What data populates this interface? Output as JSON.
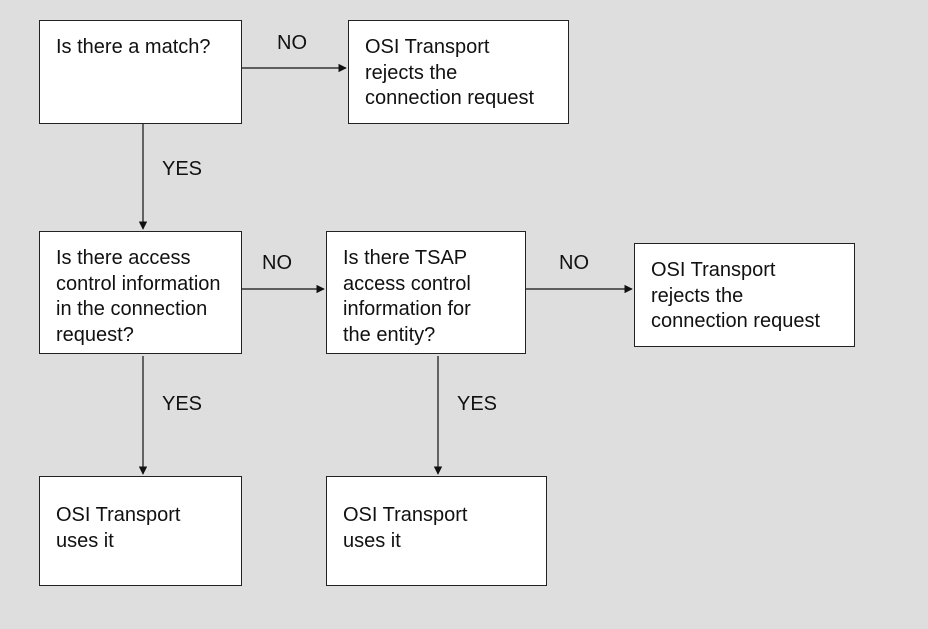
{
  "boxes": {
    "b1": "Is there a match?",
    "b2": "OSI Transport\nrejects the\nconnection request",
    "b3": "Is there access\ncontrol information\nin the connection\nrequest?",
    "b4": "Is there TSAP\naccess control\ninformation for\nthe entity?",
    "b5": "OSI Transport\nrejects the\nconnection request",
    "b6": "OSI Transport\nuses it",
    "b7": "OSI Transport\nuses it"
  },
  "labels": {
    "b1_right": "NO",
    "b1_down": "YES",
    "b3_right": "NO",
    "b3_down": "YES",
    "b4_right": "NO",
    "b4_down": "YES"
  }
}
